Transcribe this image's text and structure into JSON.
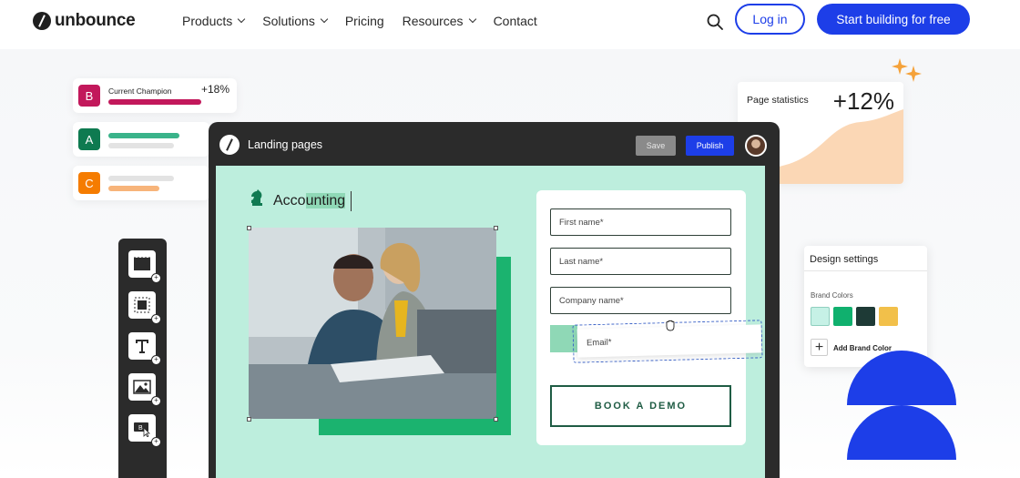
{
  "nav": {
    "brand": "unbounce",
    "menu": [
      {
        "label": "Products",
        "has_dropdown": true
      },
      {
        "label": "Solutions",
        "has_dropdown": true
      },
      {
        "label": "Pricing",
        "has_dropdown": false
      },
      {
        "label": "Resources",
        "has_dropdown": true
      },
      {
        "label": "Contact",
        "has_dropdown": false
      }
    ],
    "login_label": "Log in",
    "cta_label": "Start building for free"
  },
  "champion": {
    "rows": [
      {
        "badge": "B",
        "label": "Current Champion",
        "delta": "+18%",
        "color": "#c2185b"
      },
      {
        "badge": "A",
        "color": "#0e7a50"
      },
      {
        "badge": "C",
        "color": "#f57c00"
      }
    ]
  },
  "stats": {
    "label": "Page statistics",
    "value": "+12%"
  },
  "editor": {
    "title": "Landing pages",
    "save_label": "Save",
    "publish_label": "Publish",
    "heading_pre": "Acco",
    "heading_highlight": "unting",
    "form": {
      "fields": [
        "First name*",
        "Last name*",
        "Company name*"
      ],
      "email": "Email*",
      "button": "BOOK A DEMO"
    }
  },
  "toolbar": {
    "tools": [
      "section-tool",
      "box-tool",
      "text-tool",
      "image-tool",
      "button-tool"
    ]
  },
  "design": {
    "title": "Design settings",
    "brand_colors_label": "Brand Colors",
    "swatches": [
      "#c6f1e6",
      "#10b06e",
      "#1e3a36",
      "#f2c04a"
    ],
    "add_label": "Add Brand Color"
  },
  "colors": {
    "accent": "#1d3ee8",
    "canvas": "#bdeedd"
  }
}
